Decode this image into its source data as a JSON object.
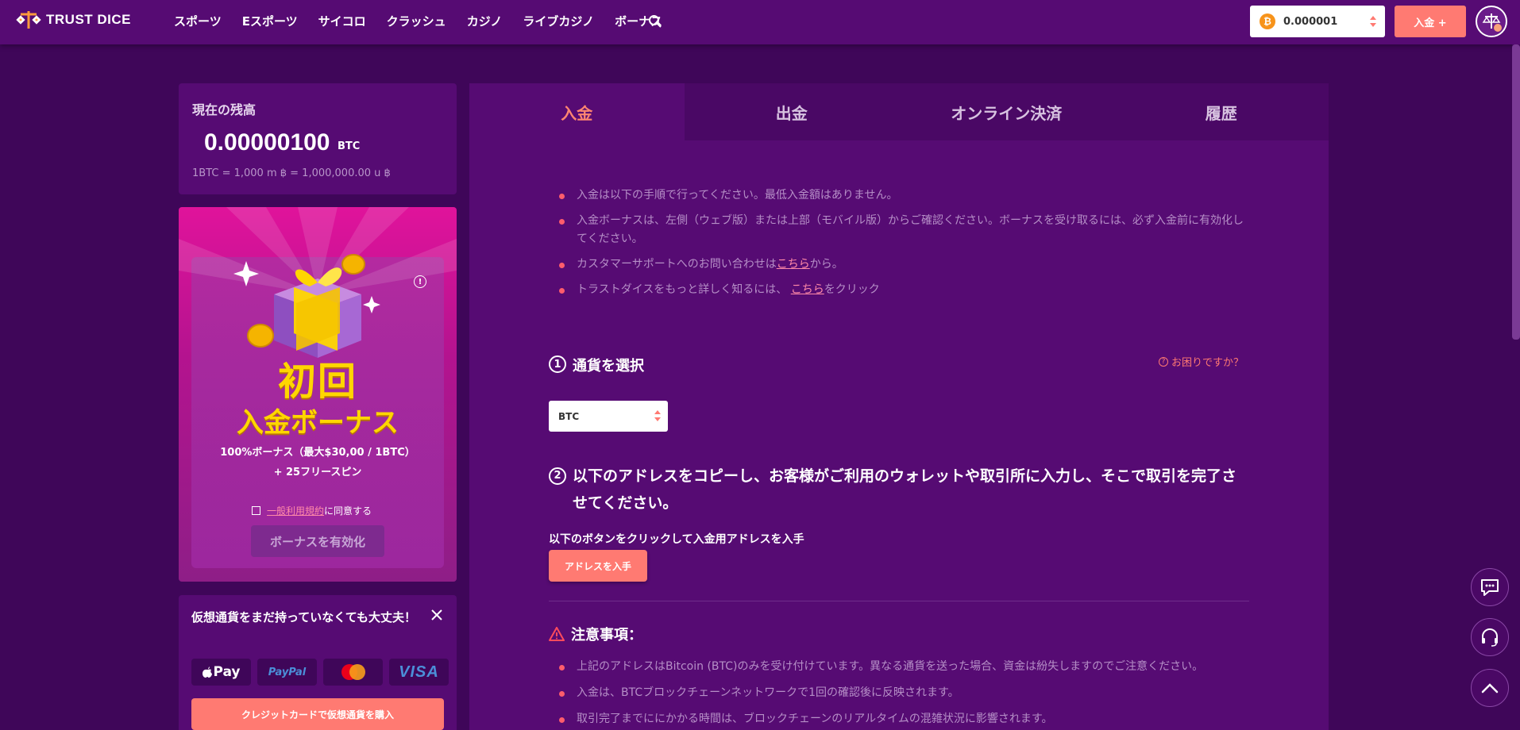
{
  "header": {
    "logo_text": "TRUST DICE",
    "nav": [
      "スポーツ",
      "Eスポーツ",
      "サイコロ",
      "クラッシュ",
      "カジノ",
      "ライブカジノ",
      "ボーナス"
    ],
    "wallet": {
      "coin_symbol": "₿",
      "value": "0.000001"
    },
    "deposit_button": "入金 +"
  },
  "balance": {
    "title": "現在の残高",
    "amount": "0.00000100",
    "unit": "BTC",
    "rate": "1BTC = 1,000 m ฿ = 1,000,000.00 u ฿"
  },
  "bonus": {
    "title_line1": "初回",
    "title_line2": "入金ボーナス",
    "desc_line1": "100%ボーナス（最大$30,00 / 1BTC）",
    "desc_line2": "+ 25フリースピン",
    "terms_link": "一般利用規約",
    "terms_suffix": "に同意する",
    "activate_button": "ボーナスを有効化",
    "info_icon_label": "!"
  },
  "crypto": {
    "title": "仮想通貨をまだ持っていなくても大丈夫！",
    "pay_methods": {
      "apple": " Pay",
      "paypal": "PayPal",
      "visa": "VISA"
    },
    "buy_button": "クレジットカードで仮想通貨を購入"
  },
  "tabs": [
    "入金",
    "出金",
    "オンライン決済",
    "履歴"
  ],
  "notes": {
    "n1": "入金は以下の手順で行ってください。最低入金額はありません。",
    "n2": "入金ボーナスは、左側（ウェブ版）または上部（モバイル版）からご確認ください。ボーナスを受け取るには、必ず入金前に有効化してください。",
    "n3_prefix": "カスタマーサポートへのお問い合わせは",
    "n3_link": "こちら",
    "n3_suffix": "から。",
    "n4_prefix": "トラストダイスをもっと詳しく知るには、 ",
    "n4_link": "こちら",
    "n4_suffix": "をクリック"
  },
  "step1": {
    "num": "1",
    "title": "通貨を選択",
    "help": "お困りですか？",
    "currency": "BTC"
  },
  "step2": {
    "num": "2",
    "title": "以下のアドレスをコピーし、お客様がご利用のウォレットや取引所に入力し、そこで取引を完了させてください。",
    "hint": "以下のボタンをクリックして入金用アドレスを入手",
    "button": "アドレスを入手"
  },
  "caution": {
    "title": "注意事項：",
    "items": [
      "上記のアドレスはBitcoin (BTC)のみを受け付けています。異なる通貨を送った場合、資金は紛失しますのでご注意ください。",
      "入金は、BTCブロックチェーンネットワークで1回の確認後に反映されます。",
      "取引完了までににかかる時間は、ブロックチェーンのリアルタイムの混雑状況に影響されます。"
    ]
  },
  "colors": {
    "background": "#3f0659",
    "panel": "#560b73",
    "accent": "#ff7a72",
    "bonus_gold": "#ffd600"
  },
  "icons": [
    "logo-icon",
    "search-icon",
    "btc-coin-icon",
    "updown-icon",
    "avatar-icon",
    "gift-icon",
    "info-icon",
    "close-icon",
    "help-icon",
    "warning-icon",
    "chat-icon",
    "headset-icon",
    "chevron-up-icon"
  ]
}
